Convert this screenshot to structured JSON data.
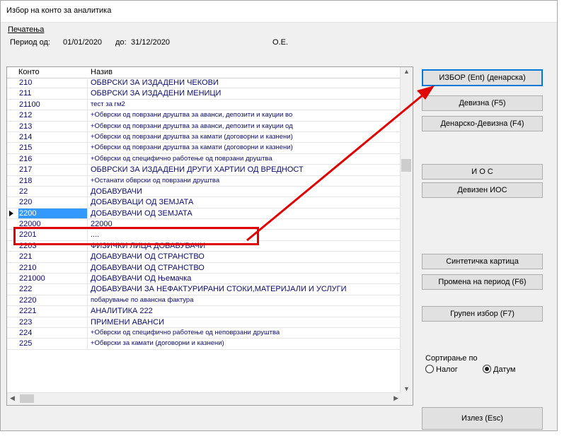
{
  "window": {
    "title": "Избор на конто за аналитика"
  },
  "menu": {
    "print_label": "Печатења"
  },
  "period": {
    "from_label": "Период од:",
    "from_value": "01/01/2020",
    "to_label": "до:",
    "to_value": "31/12/2020",
    "unit": "О.Е."
  },
  "grid": {
    "headers": {
      "konto": "Конто",
      "naziv": "Назив"
    },
    "rows": [
      {
        "konto": "210",
        "naziv": "ОБВРСКИ ЗА ИЗДАДЕНИ ЧЕКОВИ"
      },
      {
        "konto": "211",
        "naziv": "ОБВРСКИ ЗА ИЗДАДЕНИ МЕНИЦИ"
      },
      {
        "konto": "21100",
        "naziv": "тест за гм2"
      },
      {
        "konto": "212",
        "naziv": "+Обврски од поврзани друштва за аванси, депозити и кауции во"
      },
      {
        "konto": "213",
        "naziv": "+Обврски од поврзани друштва за аванси, депозити и кауции од"
      },
      {
        "konto": "214",
        "naziv": "+Обврски од поврзани друштва за камати (договорни и казнени)"
      },
      {
        "konto": "215",
        "naziv": "+Обврски од поврзани друштва за камати (договорни и казнени)"
      },
      {
        "konto": "216",
        "naziv": "+Обврски од специфично работење од поврзани друштва"
      },
      {
        "konto": "217",
        "naziv": "ОБВРСКИ ЗА ИЗДАДЕНИ ДРУГИ ХАРТИИ ОД ВРЕДНОСТ"
      },
      {
        "konto": "218",
        "naziv": "+Останати обврски од поврзани друштва"
      },
      {
        "konto": "22",
        "naziv": "ДОБАВУВАЧИ"
      },
      {
        "konto": "220",
        "naziv": "ДОБАВУВАЦИ ОД ЗЕМЈАТА"
      },
      {
        "konto": "2200",
        "naziv": "ДОБАВУВАЧИ ОД ЗЕМЈАТА"
      },
      {
        "konto": "22000",
        "naziv": "22000"
      },
      {
        "konto": "2201",
        "naziv": "...."
      },
      {
        "konto": "2203",
        "naziv": "ФИЗИЧКИ ЛИЦА ДОБАВУВАЧИ"
      },
      {
        "konto": "221",
        "naziv": "ДОБАВУВАЧИ ОД СТРАНСТВО"
      },
      {
        "konto": "2210",
        "naziv": "ДОБАВУВАЧИ ОД СТРАНСТВО"
      },
      {
        "konto": "221000",
        "naziv": "ДОБАВУВАЧИ ОД Њемачка"
      },
      {
        "konto": "222",
        "naziv": "ДОБАВУВАЧИ ЗА НЕФАКТУРИРАНИ СТОКИ,МАТЕРИЈАЛИ И УСЛУГИ"
      },
      {
        "konto": "2220",
        "naziv": "побарување по авансна фактура"
      },
      {
        "konto": "2221",
        "naziv": "АНАЛИТИКА 222"
      },
      {
        "konto": "223",
        "naziv": "ПРИМЕНИ АВАНСИ"
      },
      {
        "konto": "224",
        "naziv": "+Обврски од специфично работење од неповрзани друштва"
      },
      {
        "konto": "225",
        "naziv": "+Обврски за камати (договорни и казнени)"
      }
    ],
    "selected_index": 12
  },
  "buttons": {
    "izbor": "ИЗБОР (Ent) (денарска)",
    "devizna": "Девизна (F5)",
    "denarsko_devizna": "Денарско-Девизна (F4)",
    "ios": "И О С",
    "devizen_ios": "Девизен ИОС",
    "sinteticka": "Синтетичка картица",
    "promena": "Промена на период (F6)",
    "grupen": "Групен избор (F7)",
    "izlez": "Излез (Esc)"
  },
  "sort": {
    "label": "Сортирање по",
    "option_nalog": "Налог",
    "option_datum": "Датум",
    "selected": "Датум"
  },
  "colors": {
    "highlight": "#e00000",
    "selection": "#3399ff",
    "text": "#0b0b6b"
  }
}
